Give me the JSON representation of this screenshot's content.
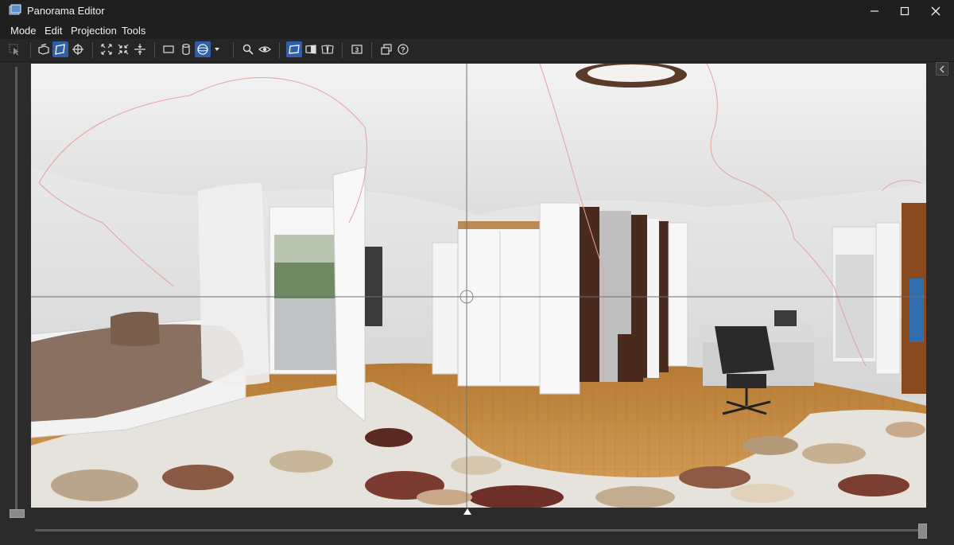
{
  "window": {
    "title": "Panorama Editor",
    "controls": {
      "minimize": "—",
      "maximize": "☐",
      "close": "✕"
    }
  },
  "menu": {
    "items": [
      {
        "label": "Mode"
      },
      {
        "label": "Edit"
      },
      {
        "label": "Projection"
      },
      {
        "label": "Tools"
      }
    ]
  },
  "toolbar": {
    "buttons": [
      {
        "icon": "cursor-select-icon",
        "active": false,
        "enabled": false
      },
      {
        "icon": "layers-icon",
        "active": false
      },
      {
        "icon": "drag-plane-icon",
        "active": true
      },
      {
        "icon": "crosshair-icon",
        "active": false
      },
      {
        "icon": "fit-expand-icon",
        "active": false
      },
      {
        "icon": "fit-collapse-icon",
        "active": false
      },
      {
        "icon": "center-vertical-icon",
        "active": false
      },
      {
        "icon": "rectangle-projection-icon",
        "active": false
      },
      {
        "icon": "cylinder-projection-icon",
        "active": false
      },
      {
        "icon": "sphere-projection-icon",
        "active": true
      },
      {
        "icon": "dropdown-arrow-icon",
        "active": false
      },
      {
        "icon": "zoom-icon",
        "active": false
      },
      {
        "icon": "eye-preview-icon",
        "active": false
      },
      {
        "icon": "view-normal-icon",
        "active": true
      },
      {
        "icon": "view-mirror-half-icon",
        "active": false
      },
      {
        "icon": "view-book-icon",
        "active": false
      },
      {
        "icon": "number-badge-icon",
        "active": false,
        "label": "3"
      },
      {
        "icon": "window-layers-icon",
        "active": false
      },
      {
        "icon": "help-icon",
        "active": false,
        "label": "?"
      }
    ]
  },
  "viewer": {
    "content": "equirectangular room panorama",
    "colors": {
      "wall": "#e6e6e6",
      "ceiling": "#ececec",
      "floor_wood": "#c89248",
      "rug": "#e4e1da",
      "dark_wood": "#4a2a1f",
      "seam_line": "#e8a0a0",
      "guide_line": "#707070"
    }
  },
  "ui_colors": {
    "accent": "#2f5fa8",
    "background": "#2b2b2b",
    "bar": "#1f1f1f"
  }
}
